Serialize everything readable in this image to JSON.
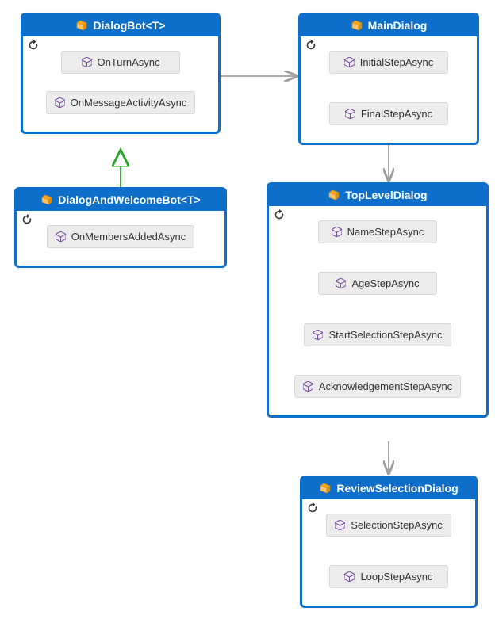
{
  "colors": {
    "box_border": "#0d6fca",
    "box_title_bg": "#0d6fca",
    "method_bg": "#ececec",
    "arrow": "#9e9e9e",
    "inherit": "#28a528",
    "cube": "#7a4ea0"
  },
  "boxes": {
    "dialogbot": {
      "title": "DialogBot<T>",
      "methods": [
        "OnTurnAsync",
        "OnMessageActivityAsync"
      ]
    },
    "dialogwelcome": {
      "title": "DialogAndWelcomeBot<T>",
      "methods": [
        "OnMembersAddedAsync"
      ]
    },
    "maindialog": {
      "title": "MainDialog",
      "methods": [
        "InitialStepAsync",
        "FinalStepAsync"
      ]
    },
    "topleveldialog": {
      "title": "TopLevelDialog",
      "methods": [
        "NameStepAsync",
        "AgeStepAsync",
        "StartSelectionStepAsync",
        "AcknowledgementStepAsync"
      ]
    },
    "reviewdialog": {
      "title": "ReviewSelectionDialog",
      "methods": [
        "SelectionStepAsync",
        "LoopStepAsync"
      ]
    }
  }
}
